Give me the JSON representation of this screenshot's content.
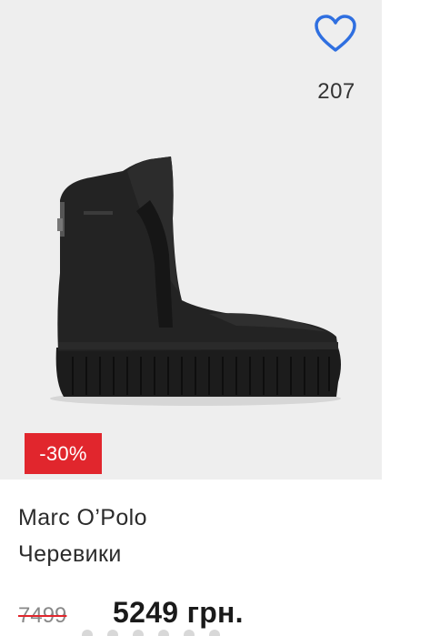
{
  "favorites": {
    "count": "207",
    "icon": "heart-outline-icon",
    "color": "#2f6fe0"
  },
  "product": {
    "discount": "-30%",
    "brand": "Marc O’Polo",
    "category": "Черевики",
    "old_price": "7499",
    "new_price": "5249 грн."
  },
  "colors": {
    "badge": "#e1262d",
    "image_background": "#eeeeee"
  }
}
